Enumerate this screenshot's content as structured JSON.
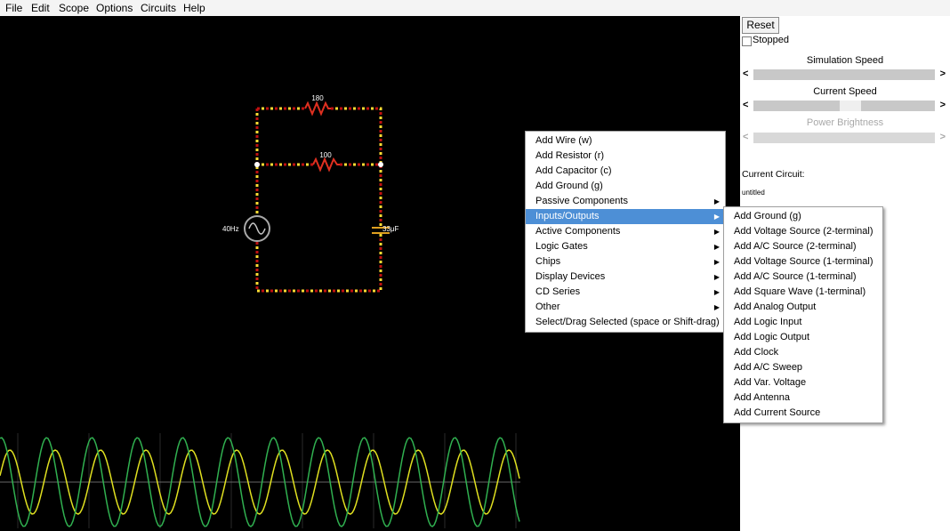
{
  "menubar": {
    "items": [
      "File",
      "Edit",
      "Scope",
      "Options",
      "Circuits",
      "Help"
    ]
  },
  "circuit": {
    "resistor1_label": "180",
    "resistor2_label": "100",
    "source_label": "40Hz",
    "capacitor_label": "33μF"
  },
  "scope": {
    "series": [
      "yellow",
      "green"
    ]
  },
  "panel": {
    "reset_label": "Reset",
    "stopped_label": "Stopped",
    "stopped_checked": false,
    "simulation_speed_label": "Simulation Speed",
    "current_speed_label": "Current Speed",
    "power_brightness_label": "Power Brightness",
    "arrow_left": "<",
    "arrow_right": ">",
    "current_circuit_label": "Current Circuit:",
    "current_circuit_name": "untitled"
  },
  "context_menu": {
    "submenu_arrow": "▶",
    "items": [
      "Add Wire (w)",
      "Add Resistor (r)",
      "Add Capacitor (c)",
      "Add Ground (g)",
      "Passive Components",
      "Inputs/Outputs",
      "Active Components",
      "Logic Gates",
      "Chips",
      "Display Devices",
      "CD Series",
      "Other",
      "Select/Drag Selected (space or Shift-drag)"
    ],
    "active_item": "Inputs/Outputs",
    "submenu_items": [
      "Add Ground (g)",
      "Add Voltage Source (2-terminal)",
      "Add A/C Source (2-terminal)",
      "Add Voltage Source (1-terminal)",
      "Add A/C Source (1-terminal)",
      "Add Square Wave (1-terminal)",
      "Add Analog Output",
      "Add Logic Input",
      "Add Logic Output",
      "Add Clock",
      "Add A/C Sweep",
      "Add Var. Voltage",
      "Add Antenna",
      "Add Current Source"
    ]
  },
  "colors": {
    "wire_current": "#ffdd33",
    "wire": "#c01010",
    "trace_yellow": "#e0e020",
    "trace_green": "#30b050",
    "menu_highlight": "#4d8fd6"
  }
}
